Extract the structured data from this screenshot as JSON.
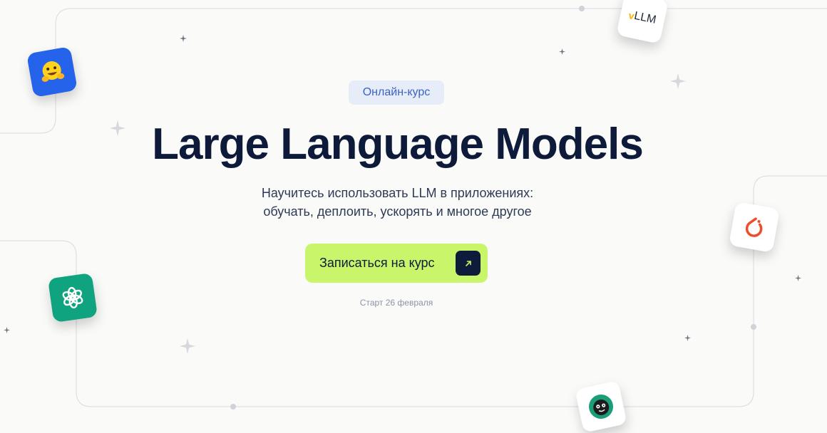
{
  "hero": {
    "badge": "Онлайн-курс",
    "title": "Large Language Models",
    "subtitle_line1": "Научитесь использовать LLM в приложениях:",
    "subtitle_line2": "обучать, деплоить, ускорять и многое другое",
    "cta_label": "Записаться на курс",
    "start_text": "Старт 26 февраля"
  },
  "tiles": {
    "vllm_text": "LLM",
    "vllm_prefix": "v"
  },
  "colors": {
    "accent": "#c9f56a",
    "navy": "#0f1b3a",
    "badge_bg": "#e6ecf8",
    "badge_text": "#3a64c4"
  },
  "icons": [
    "huggingface-logo-icon",
    "vllm-logo-icon",
    "pytorch-logo-icon",
    "openai-logo-icon",
    "sloth-logo-icon",
    "arrow-up-right-icon",
    "sparkle-icon"
  ]
}
